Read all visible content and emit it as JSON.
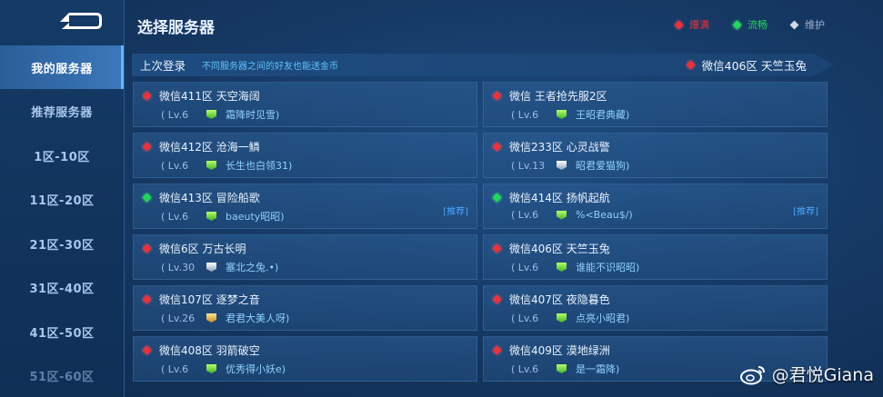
{
  "header": {
    "title": "选择服务器"
  },
  "legend": [
    {
      "label": "爆满",
      "color": "#e8323c"
    },
    {
      "label": "流畅",
      "color": "#22d65a"
    },
    {
      "label": "维护",
      "color": "#cfd9e6"
    }
  ],
  "sidebar": {
    "items": [
      {
        "label": "我的服务器",
        "active": true
      },
      {
        "label": "推荐服务器"
      },
      {
        "label": "1区-10区"
      },
      {
        "label": "11区-20区"
      },
      {
        "label": "21区-30区"
      },
      {
        "label": "31区-40区"
      },
      {
        "label": "41区-50区"
      },
      {
        "label": "51区-60区"
      }
    ]
  },
  "last_login": {
    "label": "上次登录",
    "hint": "不同服务器之间的好友也能送金币",
    "server": "微信406区 天竺玉兔",
    "status": "red"
  },
  "servers": [
    {
      "server": "微信411区 天空海阔",
      "level": "( Lv.6",
      "player": "霜降时见雪)",
      "status": "red",
      "rank": "green"
    },
    {
      "server": "微信 王者抢先服2区",
      "level": "( Lv.6",
      "player": "王昭君典藏)",
      "status": "red",
      "rank": "green"
    },
    {
      "server": "微信412区 沧海一鳞",
      "level": "( Lv.6",
      "player": "长生也白领31)",
      "status": "red",
      "rank": "green"
    },
    {
      "server": "微信233区 心灵战警",
      "level": "( Lv.13",
      "player": "昭君爱猫狗)",
      "status": "red",
      "rank": "silver"
    },
    {
      "server": "微信413区 冒险船歌",
      "level": "( Lv.6",
      "player": "baeuty昭昭)",
      "status": "green",
      "rank": "green",
      "tag": "[推荐]"
    },
    {
      "server": "微信414区 扬帆起航",
      "level": "( Lv.6",
      "player": "%<Beau$/)",
      "status": "green",
      "rank": "green",
      "tag": "[推荐]"
    },
    {
      "server": "微信6区 万古长明",
      "level": "( Lv.30",
      "player": "塞北之兔.•)",
      "status": "red",
      "rank": "silver"
    },
    {
      "server": "微信406区 天竺玉兔",
      "level": "( Lv.6",
      "player": "谁能不识昭昭)",
      "status": "red",
      "rank": "green"
    },
    {
      "server": "微信107区 逐梦之音",
      "level": "( Lv.26",
      "player": "君君大美人呀)",
      "status": "red",
      "rank": "gold"
    },
    {
      "server": "微信407区 夜隐暮色",
      "level": "( Lv.6",
      "player": "点亮小昭君)",
      "status": "red",
      "rank": "green"
    },
    {
      "server": "微信408区 羽箭破空",
      "level": "( Lv.6",
      "player": "优秀得小妖e)",
      "status": "red",
      "rank": "green"
    },
    {
      "server": "微信409区 漠地绿洲",
      "level": "( Lv.6",
      "player": "是一霜降)",
      "status": "red",
      "rank": "green"
    }
  ],
  "watermark": {
    "text": "@君悦Giana"
  }
}
